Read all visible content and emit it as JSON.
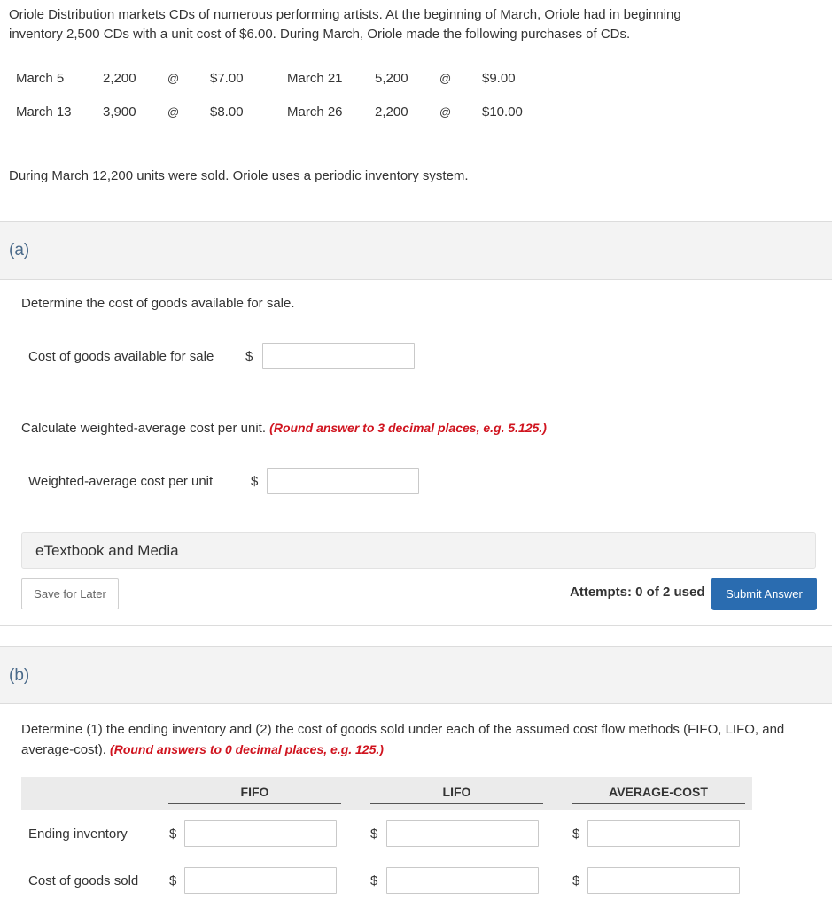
{
  "intro": {
    "line1": "Oriole Distribution markets CDs of numerous performing artists. At the beginning of March, Oriole had in beginning",
    "line2": "inventory 2,500 CDs with a unit cost of $6.00. During March, Oriole made the following purchases of CDs."
  },
  "purchases": [
    {
      "date": "March 5",
      "units": "2,200",
      "at": "@",
      "cost": "$7.00"
    },
    {
      "date": "March 13",
      "units": "3,900",
      "at": "@",
      "cost": "$8.00"
    },
    {
      "date": "March 21",
      "units": "5,200",
      "at": "@",
      "cost": "$9.00"
    },
    {
      "date": "March 26",
      "units": "2,200",
      "at": "@",
      "cost": "$10.00"
    }
  ],
  "sold_text": "During March 12,200 units were sold. Oriole uses a periodic inventory system.",
  "part_a": {
    "label": "(a)",
    "q1": "Determine the cost of goods available for sale.",
    "field1_label": "Cost of goods available for sale",
    "field1_value": "",
    "q2": "Calculate weighted-average cost per unit.",
    "q2_hint": "(Round answer to 3 decimal places, e.g. 5.125.)",
    "field2_label": "Weighted-average cost per unit",
    "field2_value": "",
    "currency": "$",
    "etextbook": "eTextbook and Media",
    "save_label": "Save for Later",
    "attempts": "Attempts: 0 of 2 used",
    "submit_label": "Submit Answer"
  },
  "part_b": {
    "label": "(b)",
    "q_line1": "Determine (1) the ending inventory and (2) the cost of goods sold under each of the assumed cost flow methods (FIFO, LIFO, and",
    "q_line2": "average-cost).",
    "q_hint": "(Round answers to 0 decimal places, e.g. 125.)",
    "columns": [
      "FIFO",
      "LIFO",
      "AVERAGE-COST"
    ],
    "rows": [
      {
        "label": "Ending inventory",
        "values": [
          "",
          "",
          ""
        ]
      },
      {
        "label": "Cost of goods sold",
        "values": [
          "",
          "",
          ""
        ]
      }
    ],
    "currency": "$"
  }
}
